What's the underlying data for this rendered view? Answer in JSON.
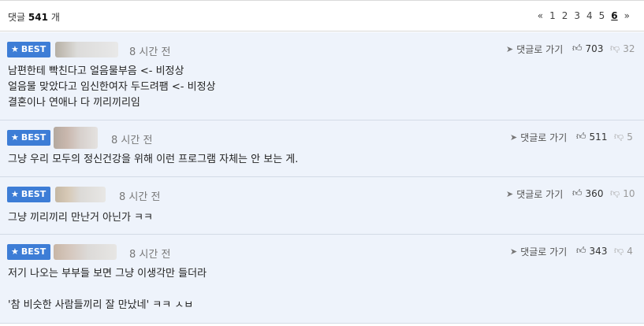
{
  "header": {
    "count_label": "댓글",
    "count_value": "541",
    "count_unit": "개",
    "pager": {
      "prev": "«",
      "pages": [
        "1",
        "2",
        "3",
        "4",
        "5",
        "6"
      ],
      "current": "6",
      "next": "»"
    }
  },
  "comments": [
    {
      "badge": "BEST",
      "time": "8 시간 전",
      "reply_label": "댓글로 가기",
      "likes": "703",
      "dislikes": "32",
      "lines": [
        "남편한테 빡친다고 얼음물부음 <- 비정상",
        "얼음물 맞았다고 임신한여자 두드려팸 <- 비정상",
        "결혼이나 연애나 다 끼리끼리임"
      ]
    },
    {
      "badge": "BEST",
      "time": "8 시간 전",
      "reply_label": "댓글로 가기",
      "likes": "511",
      "dislikes": "5",
      "lines": [
        "그냥 우리 모두의 정신건강을 위해 이런 프로그램 자체는 안 보는 게."
      ]
    },
    {
      "badge": "BEST",
      "time": "8 시간 전",
      "reply_label": "댓글로 가기",
      "likes": "360",
      "dislikes": "10",
      "lines": [
        "그냥 끼리끼리 만난거 아닌가 ㅋㅋ"
      ]
    },
    {
      "badge": "BEST",
      "time": "8 시간 전",
      "reply_label": "댓글로 가기",
      "likes": "343",
      "dislikes": "4",
      "lines": [
        "저기 나오는 부부들 보면 그냥 이생각만 들더라",
        "",
        "'참 비슷한 사람들끼리 잘 만났네' ㅋㅋ ㅅㅂ"
      ]
    }
  ],
  "icons": {
    "star": "star-icon",
    "reply": "send-arrow-icon",
    "like": "thumbs-up-icon",
    "dislike": "thumbs-down-icon"
  },
  "colors": {
    "best_badge": "#3d7dd6",
    "comment_bg": "#eef3fb"
  }
}
